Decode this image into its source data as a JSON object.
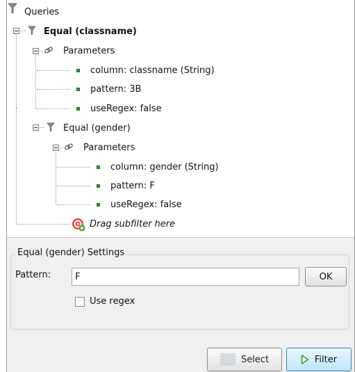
{
  "tree": {
    "root_label": "Queries",
    "equal_classname": {
      "label": "Equal (classname)",
      "parameters_label": "Parameters",
      "params": [
        "column: classname (String)",
        "pattern: 3B",
        "useRegex: false"
      ]
    },
    "equal_gender": {
      "label": "Equal (gender)",
      "parameters_label": "Parameters",
      "params": [
        "column: gender (String)",
        "pattern: F",
        "useRegex: false"
      ]
    },
    "drag_hint": "Drag subfilter here"
  },
  "settings": {
    "title": "Equal (gender) Settings",
    "pattern_label": "Pattern:",
    "pattern_value": "F",
    "ok_label": "OK",
    "use_regex_label": "Use regex",
    "use_regex_checked": false
  },
  "buttons": {
    "select_label": "Select",
    "filter_label": "Filter"
  },
  "colors": {
    "bullet": "#2e9b2e",
    "filter_accent": "#2e9b2e",
    "drag_icon": "#e0403a"
  },
  "icons": [
    "funnel-icon",
    "link-icon",
    "bullet-icon",
    "target-icon",
    "play-arrow-icon",
    "hatched-select-icon"
  ]
}
